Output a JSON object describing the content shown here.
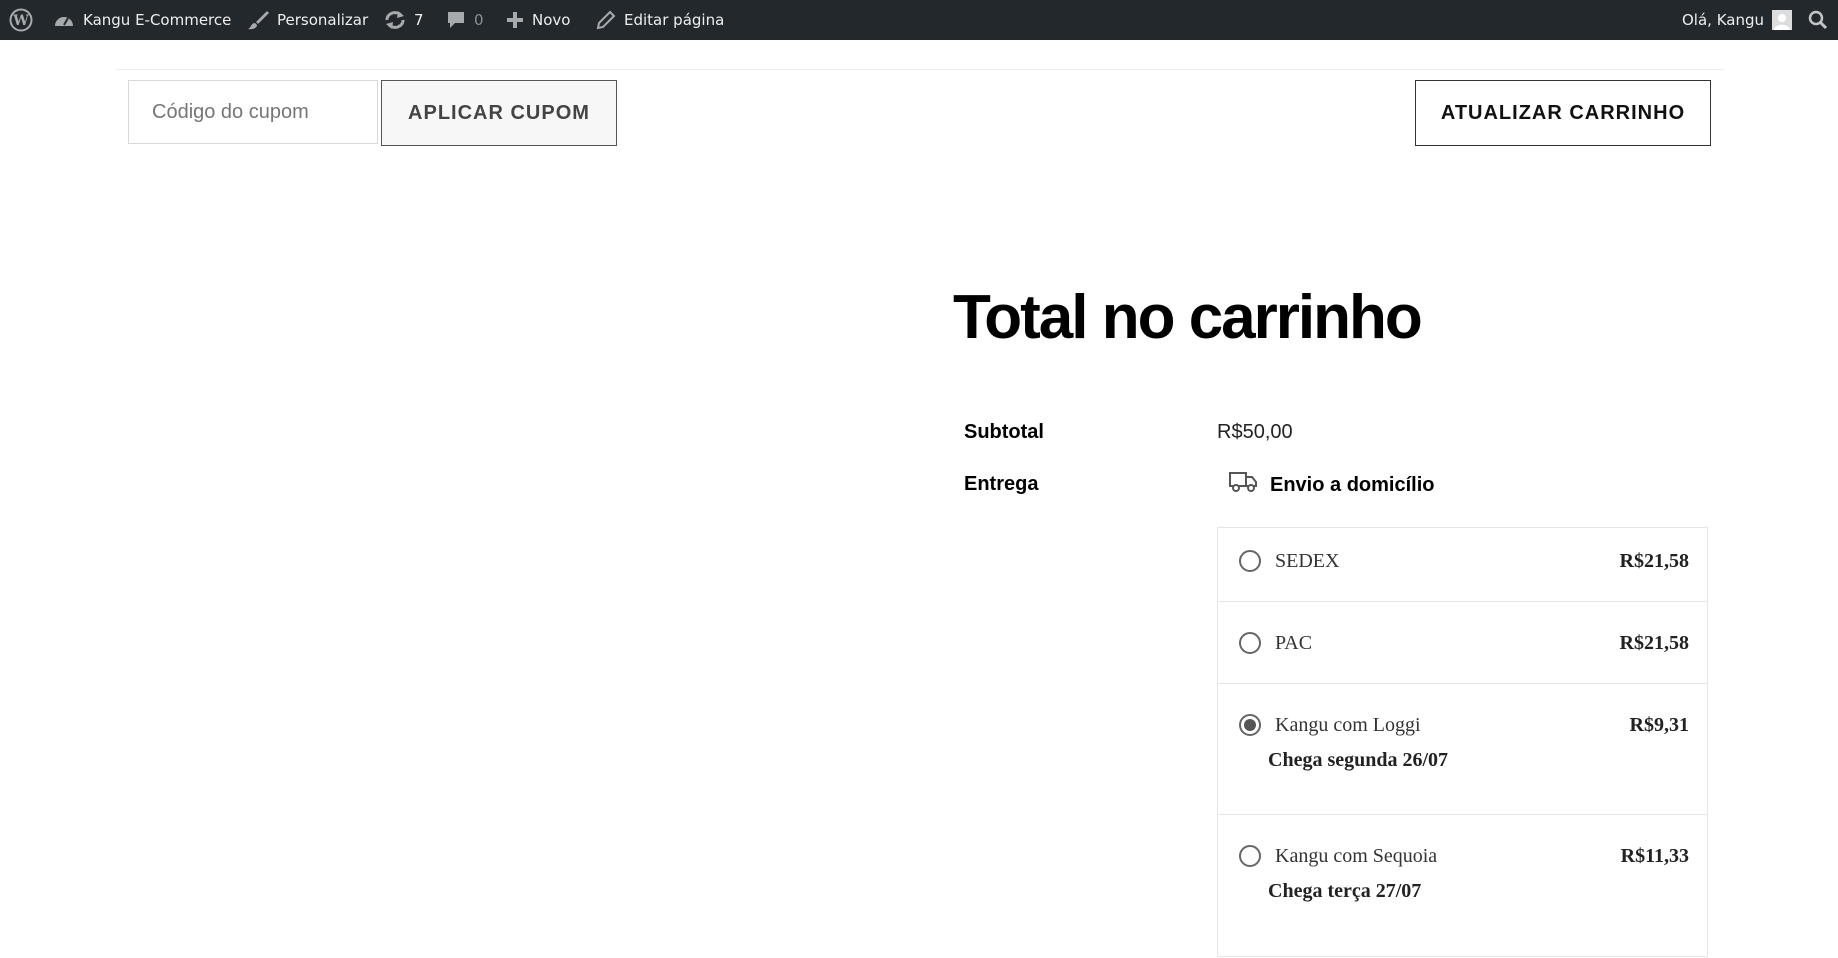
{
  "adminbar": {
    "site_name": "Kangu E-Commerce",
    "customize": "Personalizar",
    "updates_count": "7",
    "comments_count": "0",
    "new": "Novo",
    "edit_page": "Editar página",
    "greeting": "Olá, Kangu",
    "icons": [
      "wordpress-logo-icon",
      "dashboard-icon",
      "brush-icon",
      "updates-icon",
      "comment-icon",
      "plus-icon",
      "pencil-icon",
      "avatar",
      "search-icon"
    ]
  },
  "coupon": {
    "placeholder": "Código do cupom",
    "apply_label": "APLICAR CUPOM",
    "update_label": "ATUALIZAR CARRINHO"
  },
  "totals": {
    "title": "Total no carrinho",
    "subtotal_label": "Subtotal",
    "subtotal_value": "R$50,00",
    "shipping_label": "Entrega",
    "shipping_method": "Envio a domicílio",
    "options": [
      {
        "name": "SEDEX",
        "price": "R$21,58",
        "checked": false
      },
      {
        "name": "PAC",
        "price": "R$21,58",
        "checked": false
      },
      {
        "name": "Kangu com Loggi",
        "price": "R$9,31",
        "eta": "Chega segunda 26/07",
        "checked": true
      },
      {
        "name": "Kangu com Sequoia",
        "price": "R$11,33",
        "eta": "Chega terça 27/07",
        "checked": false
      }
    ]
  },
  "colors": {
    "adminbar_bg": "#23282d",
    "text": "#000000",
    "border": "#e6e6e6"
  }
}
